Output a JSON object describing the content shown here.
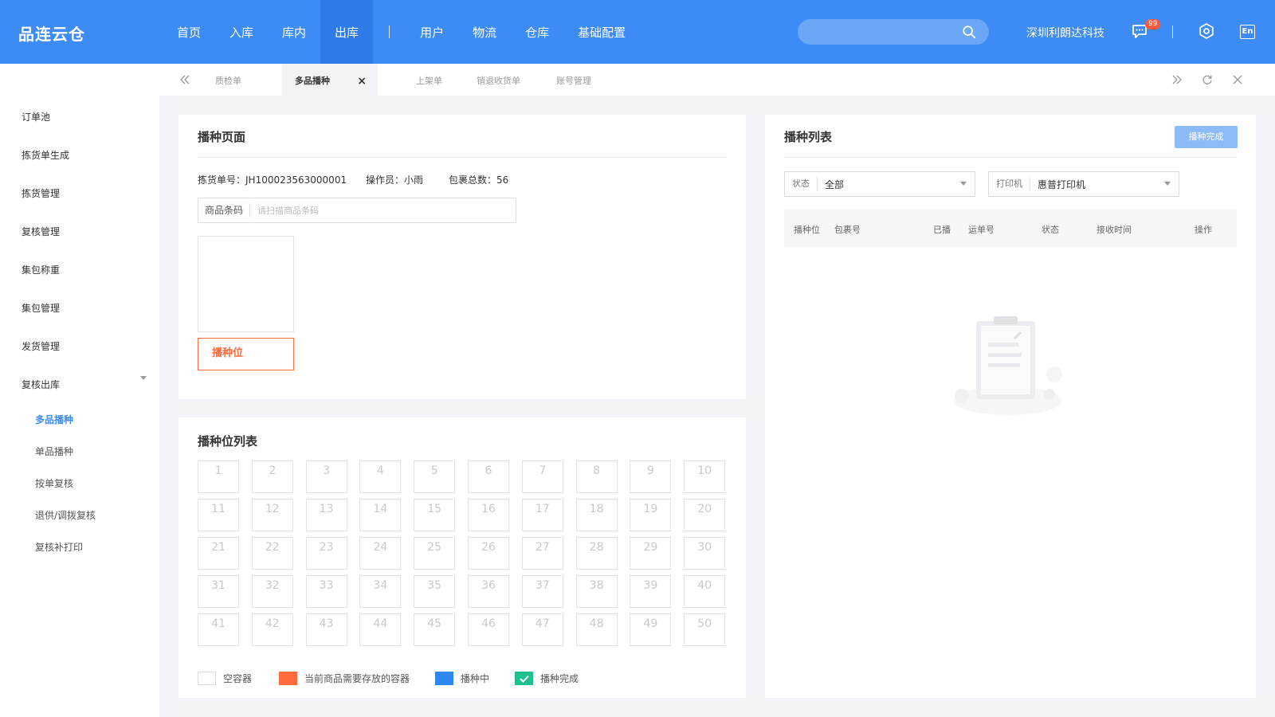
{
  "app": {
    "logo": "品连云仓"
  },
  "nav": {
    "items": [
      "首页",
      "入库",
      "库内",
      "出库",
      "用户",
      "物流",
      "仓库",
      "基础配置"
    ],
    "active_index": 3
  },
  "header": {
    "search_placeholder": "",
    "company": "深圳利朗达科技",
    "badge": "99",
    "lang": "En"
  },
  "sidebar": {
    "items": [
      "订单池",
      "拣货单生成",
      "拣货管理",
      "复核管理",
      "集包称重",
      "集包管理",
      "发货管理",
      "复核出库"
    ],
    "subitems": [
      "多品播种",
      "单品播种",
      "按单复核",
      "退供/调拨复核",
      "复核补打印"
    ],
    "active_sub": 0
  },
  "tabs": {
    "items": [
      "质检单",
      "多品播种",
      "上架单",
      "销退收货单",
      "账号管理"
    ],
    "active_index": 1,
    "close_glyph": "×"
  },
  "sow_page": {
    "title": "播种页面",
    "pick_no": "拣货单号：JH100023563000001",
    "operator": "操作员：小雨",
    "parcel_total": "包裹总数：56",
    "barcode_label": "商品条码",
    "barcode_placeholder": "请扫描商品条码",
    "slot_button": "播种位"
  },
  "slot_list": {
    "title": "播种位列表",
    "cells": [
      "1",
      "2",
      "3",
      "4",
      "5",
      "6",
      "7",
      "8",
      "9",
      "10",
      "11",
      "12",
      "13",
      "14",
      "15",
      "16",
      "17",
      "18",
      "19",
      "20",
      "21",
      "22",
      "23",
      "24",
      "25",
      "26",
      "27",
      "28",
      "29",
      "30",
      "31",
      "32",
      "33",
      "34",
      "35",
      "36",
      "37",
      "38",
      "39",
      "40",
      "41",
      "42",
      "43",
      "44",
      "45",
      "46",
      "47",
      "48",
      "49",
      "50"
    ],
    "legend": [
      {
        "label": "空容器",
        "color": "#ffffff"
      },
      {
        "label": "当前商品需要存放的容器",
        "color": "#ff6a3d"
      },
      {
        "label": "播种中",
        "color": "#2f88f0"
      },
      {
        "label": "播种完成",
        "color": "#1fc08e"
      }
    ]
  },
  "sow_list": {
    "title": "播种列表",
    "finish_button": "播种完成",
    "status_label": "状态",
    "status_value": "全部",
    "printer_label": "打印机",
    "printer_value": "惠普打印机",
    "columns": [
      "播种位",
      "包裹号",
      "已播",
      "运单号",
      "状态",
      "接收时间",
      "操作"
    ]
  },
  "colors": {
    "primary": "#3d8bf5",
    "accent_orange": "#ff6a3d",
    "finish_button": "#8dbbfa"
  }
}
